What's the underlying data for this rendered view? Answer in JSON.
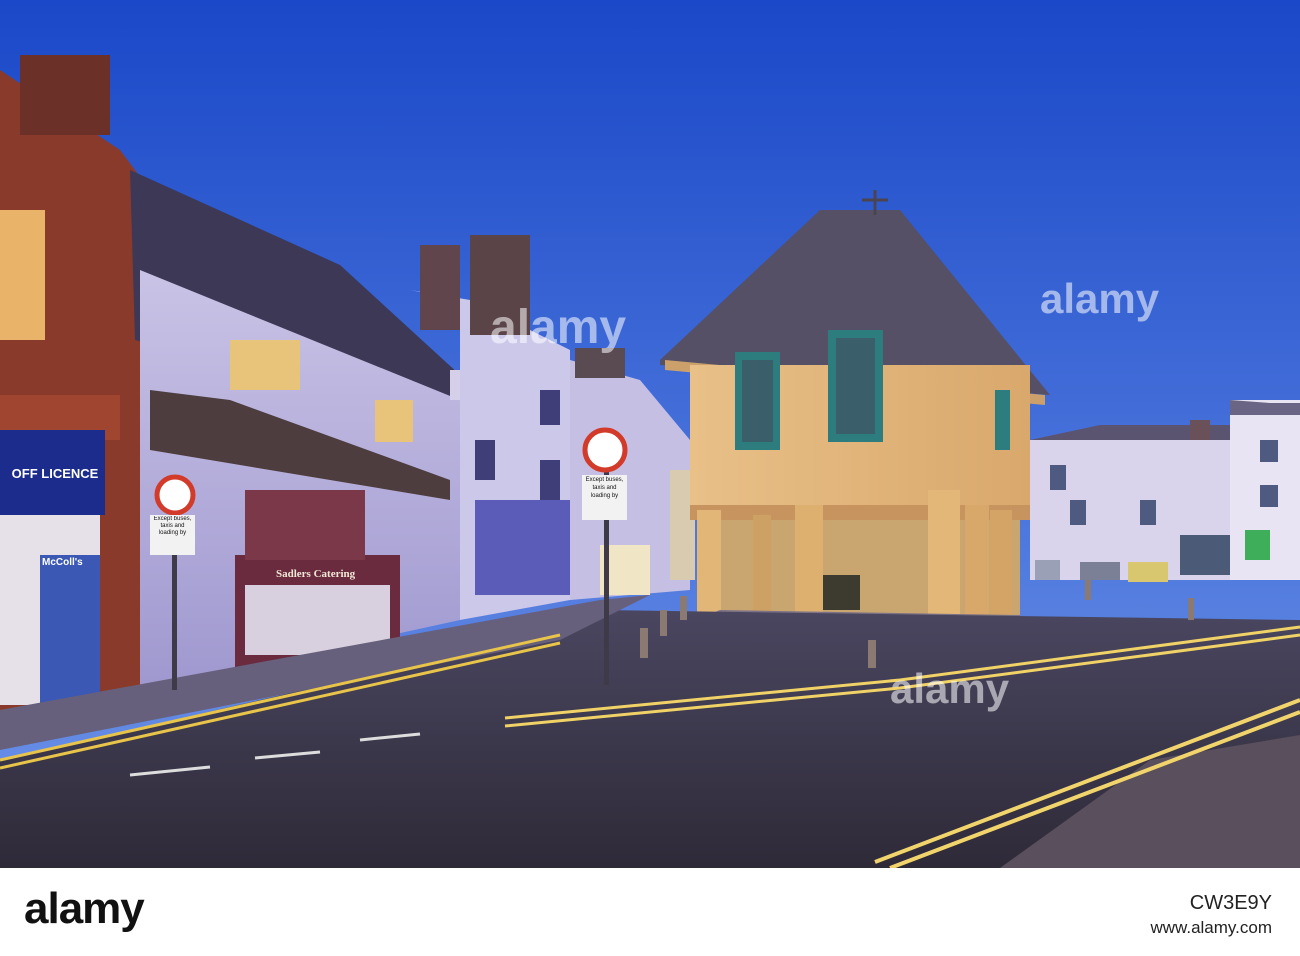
{
  "scene": {
    "shop_sign_off_licence": "OFF LICENCE",
    "shop_sign_mccolls": "McColl's",
    "shop_sign_sadlers": "Sadlers Catering",
    "road_sign_text": "Except buses, taxis and loading by",
    "road_sign_text_2": "Except buses, taxis and loading by"
  },
  "watermark": {
    "center": "alamy",
    "right": "alamy",
    "bottom": "alamy"
  },
  "footer": {
    "logo": "alamy",
    "stock_id": "CW3E9Y",
    "url": "www.alamy.com"
  },
  "colors": {
    "sky_top": "#1d4fd0",
    "sky_bottom": "#5a86e6",
    "market_house": "#e6b87a",
    "road": "#3a3a4a"
  }
}
